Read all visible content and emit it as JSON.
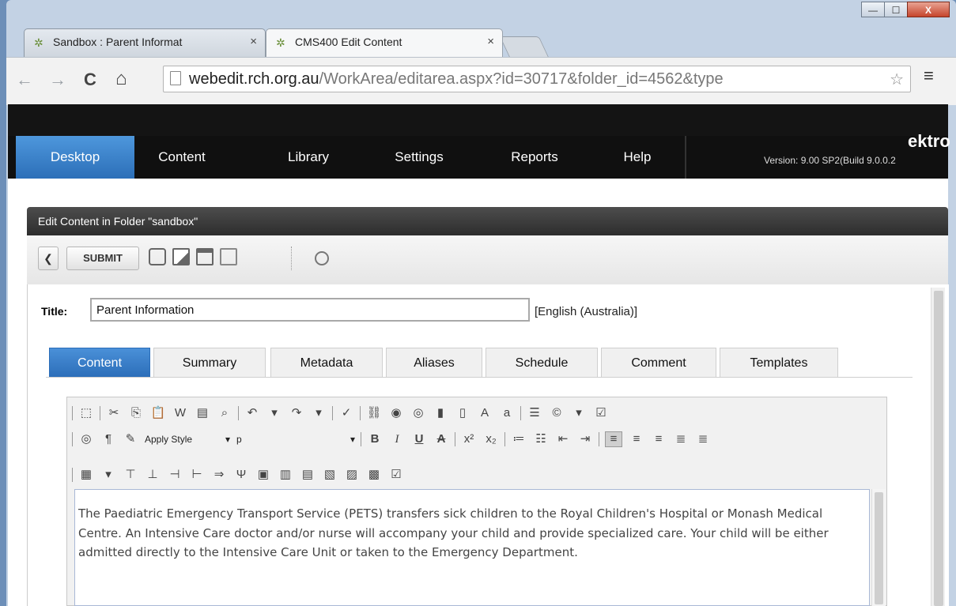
{
  "browser": {
    "tabs": [
      {
        "title": "Sandbox : Parent Informat",
        "active": false
      },
      {
        "title": "CMS400 Edit Content",
        "active": true
      }
    ],
    "tab_close": "×",
    "url_domain": "webedit.rch.org.au",
    "url_path": "/WorkArea/editarea.aspx?id=30717&folder_id=4562&type",
    "back_glyph": "←",
    "forward_glyph": "→",
    "reload_glyph": "C",
    "home_glyph": "⌂",
    "star_glyph": "☆",
    "menu_glyph": "≡",
    "window_buttons": {
      "minimize": "—",
      "maximize": "☐",
      "close": "X"
    }
  },
  "cms": {
    "brand": "ektro",
    "version": "Version: 9.00 SP2(Build 9.0.0.2",
    "nav": [
      {
        "label": "Desktop",
        "active": true
      },
      {
        "label": "Content",
        "active": false
      },
      {
        "label": "Library",
        "active": false
      },
      {
        "label": "Settings",
        "active": false
      },
      {
        "label": "Reports",
        "active": false
      },
      {
        "label": "Help",
        "active": false
      }
    ]
  },
  "panel": {
    "heading": "Edit Content in Folder \"sandbox\"",
    "back_glyph": "❮",
    "submit_label": "SUBMIT"
  },
  "form": {
    "title_label": "Title:",
    "title_value": "Parent Information",
    "language": "[English (Australia)]",
    "tabs": [
      {
        "label": "Content",
        "active": true
      },
      {
        "label": "Summary",
        "active": false
      },
      {
        "label": "Metadata",
        "active": false
      },
      {
        "label": "Aliases",
        "active": false
      },
      {
        "label": "Schedule",
        "active": false
      },
      {
        "label": "Comment",
        "active": false
      },
      {
        "label": "Templates",
        "active": false
      }
    ]
  },
  "editor": {
    "style_select": "Apply Style",
    "format_select": "p",
    "bold": "B",
    "italic": "I",
    "underline": "U",
    "strike": "A",
    "body_text": "The Paediatric Emergency Transport Service (PETS) transfers sick children to the Royal Children's Hospital or Monash Medical Centre. An Intensive Care doctor and/or nurse will accompany your child and provide specialized care. Your child will be either admitted directly to the Intensive Care Unit or taken to the Emergency Department."
  }
}
